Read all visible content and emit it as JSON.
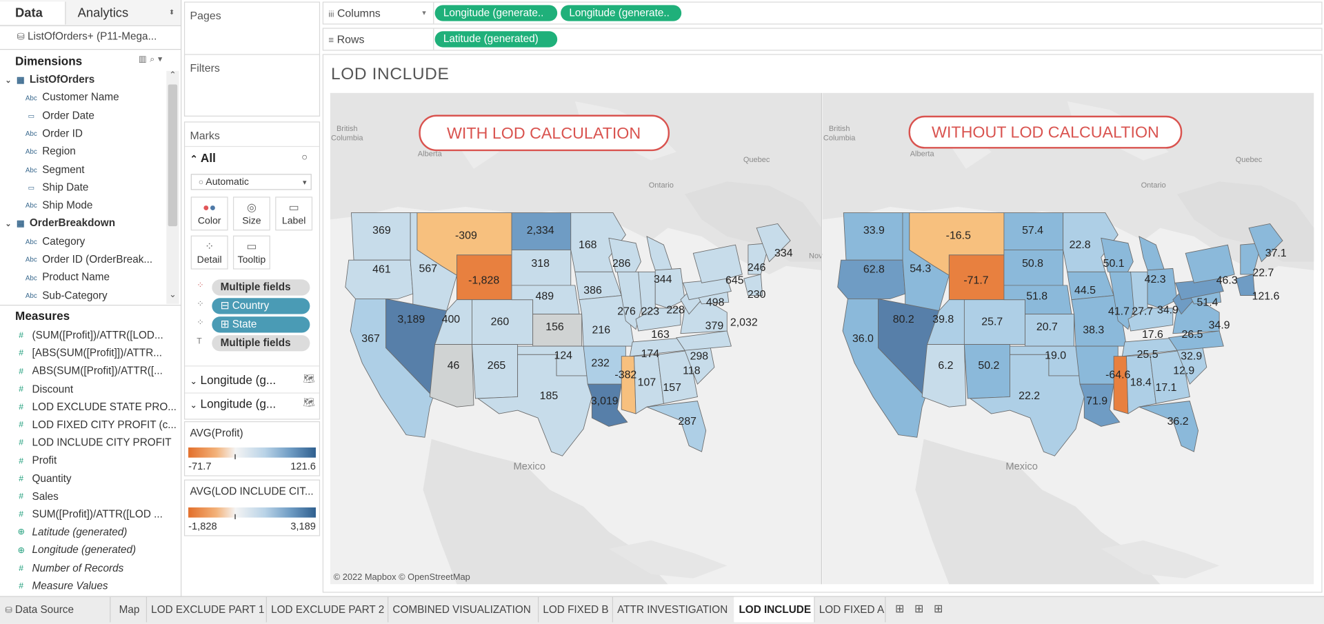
{
  "left_pane": {
    "tabs": [
      "Data",
      "Analytics"
    ],
    "datasource": "ListOfOrders+ (P11-Mega...",
    "dimensions_title": "Dimensions",
    "groups": [
      {
        "name": "ListOfOrders",
        "fields": [
          {
            "type": "Abc",
            "name": "Customer Name"
          },
          {
            "type": "date",
            "name": "Order Date"
          },
          {
            "type": "Abc",
            "name": "Order ID"
          },
          {
            "type": "Abc",
            "name": "Region"
          },
          {
            "type": "Abc",
            "name": "Segment"
          },
          {
            "type": "date",
            "name": "Ship Date"
          },
          {
            "type": "Abc",
            "name": "Ship Mode"
          }
        ]
      },
      {
        "name": "OrderBreakdown",
        "fields": [
          {
            "type": "Abc",
            "name": "Category"
          },
          {
            "type": "Abc",
            "name": "Order ID (OrderBreak..."
          },
          {
            "type": "Abc",
            "name": "Product Name"
          },
          {
            "type": "Abc",
            "name": "Sub-Category"
          }
        ]
      }
    ],
    "measures_title": "Measures",
    "measures": [
      {
        "name": "(SUM([Profit])/ATTR([LOD...",
        "italic": false
      },
      {
        "name": "[ABS(SUM([Profit]])/ATTR...",
        "italic": false
      },
      {
        "name": "ABS(SUM([Profit])/ATTR([...",
        "italic": false
      },
      {
        "name": "Discount",
        "italic": false
      },
      {
        "name": "LOD EXCLUDE STATE PRO...",
        "italic": false
      },
      {
        "name": "LOD FIXED CITY PROFIT (c...",
        "italic": false
      },
      {
        "name": "LOD INCLUDE CITY PROFIT",
        "italic": false
      },
      {
        "name": "Profit",
        "italic": false
      },
      {
        "name": "Quantity",
        "italic": false
      },
      {
        "name": "Sales",
        "italic": false
      },
      {
        "name": "SUM([Profit])/ATTR([LOD ...",
        "italic": false
      },
      {
        "name": "Latitude (generated)",
        "italic": true
      },
      {
        "name": "Longitude (generated)",
        "italic": true
      },
      {
        "name": "Number of Records",
        "italic": true
      },
      {
        "name": "Measure Values",
        "italic": true
      }
    ]
  },
  "shelves": {
    "pages_label": "Pages",
    "filters_label": "Filters",
    "columns_label": "Columns",
    "rows_label": "Rows",
    "columns_pills": [
      "Longitude (generate..",
      "Longitude (generate.."
    ],
    "rows_pills": [
      "Latitude (generated)"
    ]
  },
  "marks": {
    "title": "Marks",
    "all_label": "All",
    "mark_type": "Automatic",
    "buttons": [
      "Color",
      "Size",
      "Label",
      "Detail",
      "Tooltip"
    ],
    "fields": [
      "Multiple fields",
      "Country",
      "State",
      "Multiple fields"
    ],
    "sublayers": [
      "Longitude (g...",
      "Longitude (g..."
    ]
  },
  "legends": [
    {
      "title": "AVG(Profit)",
      "min": "-71.7",
      "max": "121.6"
    },
    {
      "title": "AVG(LOD INCLUDE CIT...",
      "min": "-1,828",
      "max": "3,189"
    }
  ],
  "view": {
    "title": "LOD INCLUDE",
    "left_banner": "WITH LOD CALCULATION",
    "right_banner": "WITHOUT LOD CALCUALTION",
    "attribution": "© 2022 Mapbox © OpenStreetMap",
    "geo_labels": [
      "British Columbia",
      "Alberta",
      "Quebec",
      "Ontario",
      "Mexico",
      "Nov"
    ],
    "colors": {
      "neg_strong": "#e8803f",
      "neg_light": "#f7c07e",
      "neutral": "#d0d3d3",
      "pos_lightest": "#c7dcea",
      "pos_light": "#aecfe6",
      "pos_mid": "#8bb9da",
      "pos_dark": "#6f9cc4",
      "pos_darker": "#577fa9"
    }
  },
  "chart_data": [
    {
      "type": "map",
      "title": "WITH LOD CALCULATION",
      "measure": "AVG(LOD INCLUDE CITY PROFIT)",
      "labels": [
        "369",
        "-309",
        "2,334",
        "461",
        "567",
        "-1,828",
        "318",
        "168",
        "286",
        "344",
        "334",
        "645",
        "246",
        "489",
        "386",
        "498",
        "230",
        "3,189",
        "400",
        "260",
        "156",
        "216",
        "276",
        "223",
        "228",
        "379",
        "2,032",
        "367",
        "163",
        "46",
        "265",
        "124",
        "232",
        "174",
        "298",
        "-382",
        "107",
        "118",
        "157",
        "185",
        "3,019",
        "287"
      ]
    },
    {
      "type": "map",
      "title": "WITHOUT LOD CALCUALTION",
      "measure": "AVG(Profit)",
      "labels": [
        "33.9",
        "-16.5",
        "57.4",
        "62.8",
        "54.3",
        "-71.7",
        "50.8",
        "22.8",
        "50.1",
        "42.3",
        "37.1",
        "22.7",
        "46.3",
        "51.8",
        "44.5",
        "51.4",
        "121.6",
        "80.2",
        "39.8",
        "25.7",
        "20.7",
        "38.3",
        "41.7",
        "27.7",
        "34.9",
        "36.0",
        "17.6",
        "26.5",
        "34.9",
        "6.2",
        "50.2",
        "19.0",
        "25.5",
        "32.9",
        "12.9",
        "-64.6",
        "18.4",
        "17.1",
        "22.2",
        "71.9",
        "36.2"
      ]
    }
  ],
  "tabs": {
    "datasource": "Data Source",
    "sheets": [
      "Map",
      "LOD EXCLUDE PART 1",
      "LOD EXCLUDE PART 2",
      "COMBINED VISUALIZATION",
      "LOD FIXED B",
      "ATTR INVESTIGATION",
      "LOD INCLUDE",
      "LOD FIXED  A"
    ],
    "active": "LOD INCLUDE"
  }
}
